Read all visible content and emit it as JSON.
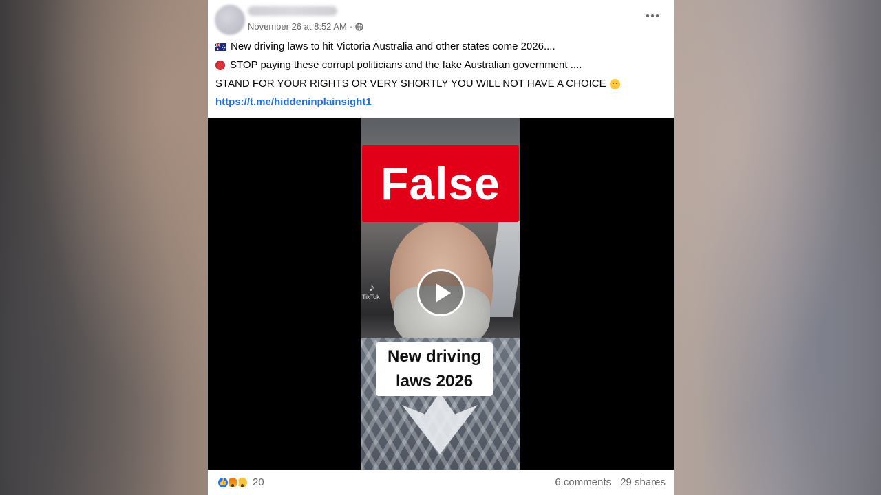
{
  "post": {
    "timestamp": "November 26 at 8:52 AM",
    "separator": "·",
    "audience_icon": "globe-icon",
    "menu_icon": "more-icon",
    "lines": [
      {
        "icon": "australia-flag-icon",
        "text": "New driving laws to hit Victoria Australia and other states come 2026...."
      },
      {
        "icon": "stop-sign-icon",
        "text": "STOP paying these corrupt politicians and the fake Australian government ...."
      },
      {
        "text": "STAND FOR YOUR RIGHTS OR VERY SHORTLY YOU WILL NOT HAVE A CHOICE",
        "trailing_icon": "face-emoji-icon"
      }
    ],
    "link": "https://t.me/hiddeninplainsight1"
  },
  "video": {
    "rating_label": "False",
    "rating_color": "#e10018",
    "caption_line1": "New driving",
    "caption_line2": "laws 2026",
    "watermark": "TikTok",
    "play_icon": "play-icon"
  },
  "footer": {
    "reaction_icons": [
      "like-icon",
      "angry-icon",
      "wow-icon"
    ],
    "reaction_count": "20",
    "comments": "6 comments",
    "shares": "29 shares"
  }
}
